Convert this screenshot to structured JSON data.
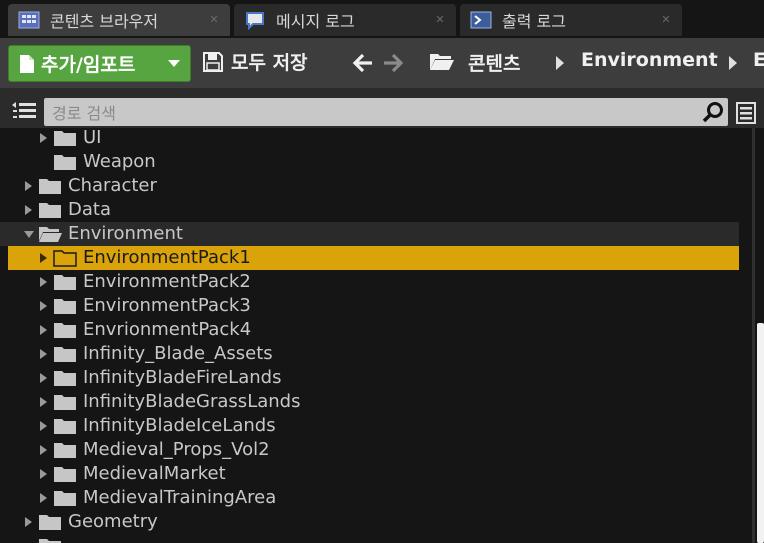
{
  "tabs": [
    {
      "label": "콘텐츠 브라우저",
      "icon": "content-browser-icon",
      "active": true
    },
    {
      "label": "메시지 로그",
      "icon": "message-log-icon",
      "active": false
    },
    {
      "label": "출력 로그",
      "icon": "output-log-icon",
      "active": false
    }
  ],
  "toolbar": {
    "add_import_label": "추가/임포트",
    "save_all_label": "모두 저장"
  },
  "breadcrumb": [
    "콘텐츠",
    "Environment",
    "E"
  ],
  "search": {
    "placeholder": "경로 검색"
  },
  "tree": [
    {
      "label": "UI",
      "expandable": true,
      "expanded": false,
      "selected": false
    },
    {
      "label": "Weapon",
      "expandable": false,
      "expanded": false,
      "selected": false
    },
    {
      "label": "Character",
      "expandable": true,
      "expanded": false,
      "selected": false
    },
    {
      "label": "Data",
      "expandable": true,
      "expanded": false,
      "selected": false
    },
    {
      "label": "Environment",
      "expandable": true,
      "expanded": true,
      "selected": false
    },
    {
      "label": "EnvironmentPack1",
      "expandable": true,
      "expanded": false,
      "selected": true
    },
    {
      "label": "EnvironmentPack2",
      "expandable": true,
      "expanded": false,
      "selected": false
    },
    {
      "label": "EnvironmentPack3",
      "expandable": true,
      "expanded": false,
      "selected": false
    },
    {
      "label": "EnvrionmentPack4",
      "expandable": true,
      "expanded": false,
      "selected": false
    },
    {
      "label": "Infinity_Blade_Assets",
      "expandable": true,
      "expanded": false,
      "selected": false
    },
    {
      "label": "InfinityBladeFireLands",
      "expandable": true,
      "expanded": false,
      "selected": false
    },
    {
      "label": "InfinityBladeGrassLands",
      "expandable": true,
      "expanded": false,
      "selected": false
    },
    {
      "label": "InfinityBladeIceLands",
      "expandable": true,
      "expanded": false,
      "selected": false
    },
    {
      "label": "Medieval_Props_Vol2",
      "expandable": true,
      "expanded": false,
      "selected": false
    },
    {
      "label": "MedievalMarket",
      "expandable": true,
      "expanded": false,
      "selected": false
    },
    {
      "label": "MedievalTrainingArea",
      "expandable": true,
      "expanded": false,
      "selected": false
    },
    {
      "label": "Geometry",
      "expandable": true,
      "expanded": false,
      "selected": false
    }
  ],
  "colors": {
    "add_button": "#56a540",
    "selection": "#dba30a",
    "toolbar_bg": "#3d3d3d"
  }
}
